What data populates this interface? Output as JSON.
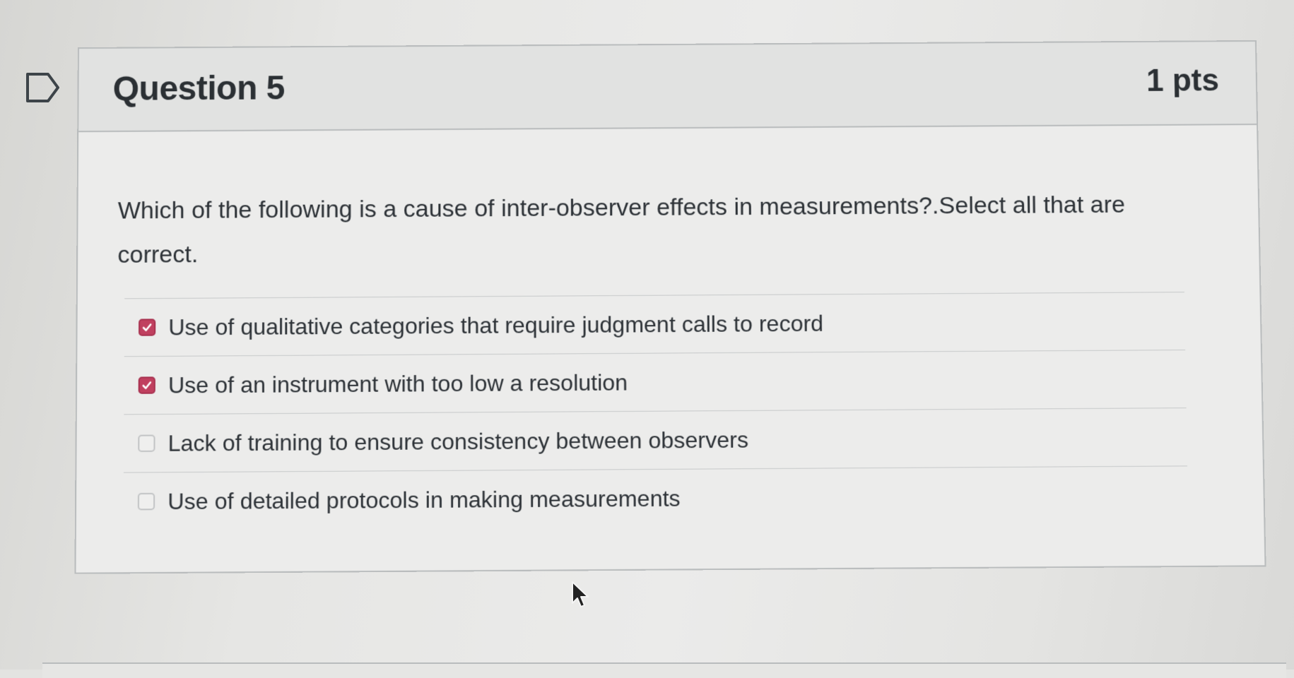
{
  "question": {
    "title": "Question 5",
    "points": "1 pts",
    "text": "Which of the following is a cause of inter-observer effects in measurements?.Select all that are correct.",
    "flag_icon": "flag-outline-icon"
  },
  "answers": [
    {
      "label": "Use of qualitative categories that require judgment calls to record",
      "checked": true
    },
    {
      "label": "Use of an instrument with too low a resolution",
      "checked": true
    },
    {
      "label": "Lack of training to ensure consistency between observers",
      "checked": false
    },
    {
      "label": "Use of detailed protocols in making measurements",
      "checked": false
    }
  ],
  "colors": {
    "checkbox_checked": "#c0405f",
    "text": "#2d3237",
    "border": "#b9bcbd"
  },
  "cursor_icon": "mouse-pointer-icon"
}
